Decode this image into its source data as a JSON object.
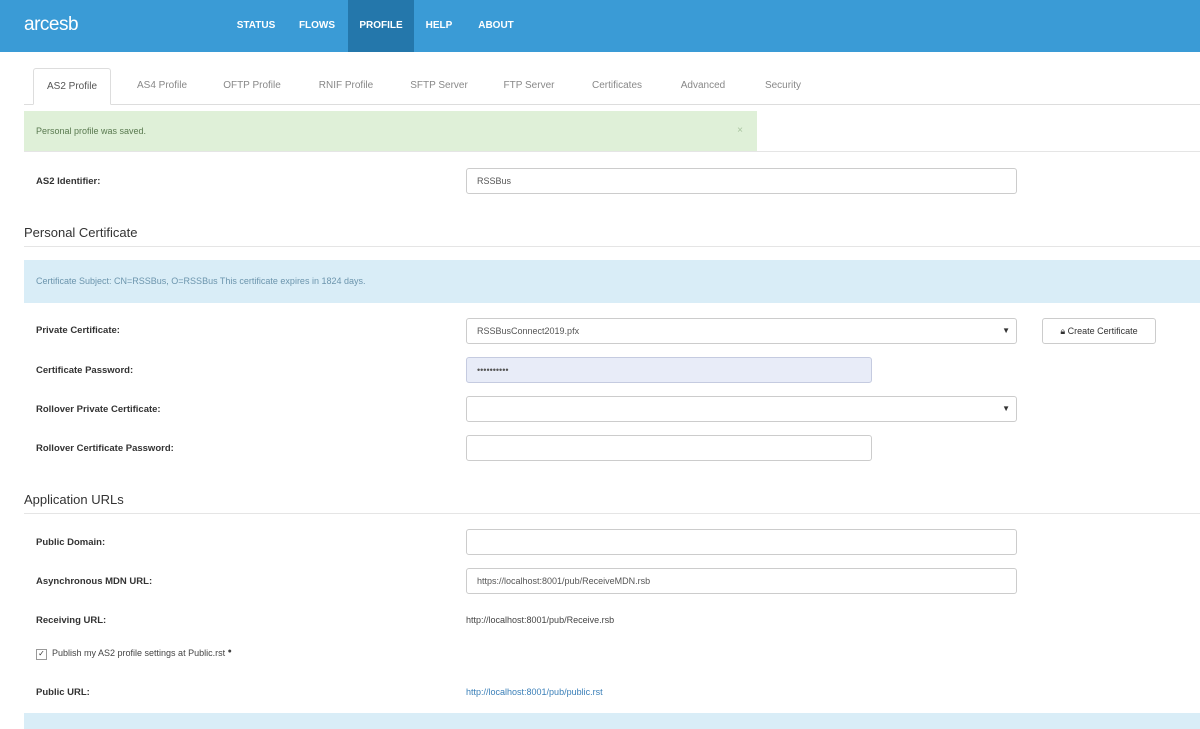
{
  "header": {
    "logo": "arcesb",
    "nav": [
      {
        "label": "STATUS",
        "active": false
      },
      {
        "label": "FLOWS",
        "active": false
      },
      {
        "label": "PROFILE",
        "active": true
      },
      {
        "label": "HELP",
        "active": false
      },
      {
        "label": "ABOUT",
        "active": false
      }
    ]
  },
  "tabs": [
    {
      "label": "AS2 Profile",
      "active": true
    },
    {
      "label": "AS4 Profile"
    },
    {
      "label": "OFTP Profile"
    },
    {
      "label": "RNIF Profile"
    },
    {
      "label": "SFTP Server"
    },
    {
      "label": "FTP Server"
    },
    {
      "label": "Certificates"
    },
    {
      "label": "Advanced"
    },
    {
      "label": "Security"
    }
  ],
  "alert_success": {
    "text": "Personal profile was saved.",
    "close": "×"
  },
  "as2_identifier": {
    "label": "AS2 Identifier:",
    "value": "RSSBus"
  },
  "personal_certificate": {
    "heading": "Personal Certificate",
    "info": "Certificate Subject: CN=RSSBus, O=RSSBus This certificate expires in 1824 days.",
    "private_cert_label": "Private Certificate:",
    "private_cert_value": "RSSBusConnect2019.pfx",
    "create_button": "Create Certificate",
    "cert_password_label": "Certificate Password:",
    "cert_password_value": "••••••••••",
    "rollover_cert_label": "Rollover Private Certificate:",
    "rollover_cert_value": "",
    "rollover_password_label": "Rollover Certificate Password:",
    "rollover_password_value": ""
  },
  "application_urls": {
    "heading": "Application URLs",
    "public_domain_label": "Public Domain:",
    "public_domain_value": "",
    "async_mdn_label": "Asynchronous MDN URL:",
    "async_mdn_value": "https://localhost:8001/pub/ReceiveMDN.rsb",
    "receiving_url_label": "Receiving URL:",
    "receiving_url_value": "http://localhost:8001/pub/Receive.rsb",
    "publish_checkbox_label": "Publish my AS2 profile settings at Public.rst",
    "publish_checked": true,
    "public_url_label": "Public URL:",
    "public_url_value": "http://localhost:8001/pub/public.rst"
  },
  "icons": {
    "lock": "lock-icon",
    "dropdown": "caret-down-icon",
    "info": "info-icon",
    "check": "check-icon"
  },
  "colors": {
    "topbar": "#3a9bd6",
    "nav_active": "#2477ab",
    "alert_success_bg": "#dff0d8",
    "alert_info_bg": "#d9edf7",
    "link": "#3a7fb8"
  }
}
